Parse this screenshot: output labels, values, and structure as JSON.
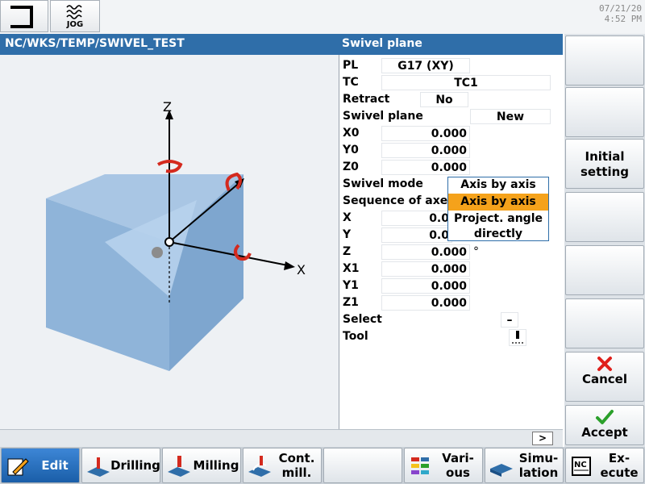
{
  "top": {
    "mode_label": "JOG",
    "date": "07/21/20",
    "time": "4:52 PM"
  },
  "titlebar": {
    "path": "NC/WKS/TEMP/SWIVEL_TEST",
    "panel_title": "Swivel plane"
  },
  "graphic": {
    "axis_x": "X",
    "axis_z": "Z"
  },
  "form": {
    "pl": {
      "label": "PL",
      "value": "G17 (XY)"
    },
    "tc": {
      "label": "TC",
      "value": "TC1"
    },
    "retract": {
      "label": "Retract",
      "value": "No"
    },
    "swivel_plane": {
      "label": "Swivel plane",
      "value": "New"
    },
    "x0": {
      "label": "X0",
      "value": "0.000"
    },
    "y0": {
      "label": "Y0",
      "value": "0.000"
    },
    "z0": {
      "label": "Z0",
      "value": "0.000"
    },
    "swivel_mode": {
      "label": "Swivel mode",
      "value": "Axis by axis",
      "options": [
        "Axis by axis",
        "Project. angle directly"
      ]
    },
    "sequence": {
      "label": "Sequence of axes"
    },
    "x": {
      "label": "X",
      "value": "0.0"
    },
    "y": {
      "label": "Y",
      "value": "0.0"
    },
    "z": {
      "label": "Z",
      "value": "0.000",
      "unit": "°"
    },
    "x1": {
      "label": "X1",
      "value": "0.000"
    },
    "y1": {
      "label": "Y1",
      "value": "0.000"
    },
    "z1": {
      "label": "Z1",
      "value": "0.000"
    },
    "select": {
      "label": "Select",
      "value": "–"
    },
    "tool": {
      "label": "Tool"
    }
  },
  "status": {
    "more_label": ">"
  },
  "vertical_softkeys": {
    "initial_setting": [
      "Initial",
      "setting"
    ],
    "cancel": "Cancel",
    "accept": "Accept"
  },
  "horizontal_softkeys": {
    "edit": "Edit",
    "drilling": "Drilling",
    "milling": "Milling",
    "cont_mill": [
      "Cont.",
      "mill."
    ],
    "various": [
      "Vari-",
      "ous"
    ],
    "simulation": [
      "Simu-",
      "lation"
    ],
    "execute": [
      "Ex-",
      "ecute"
    ]
  },
  "colors": {
    "title_bar": "#2f6ea9",
    "dropdown_highlight": "#f5a21b",
    "active_softkey": "#1a5ea8",
    "cancel_icon": "#e0201b",
    "accept_icon": "#2ba02b",
    "swivel_arrow": "#d42a1e",
    "cube_face": "#8fb4d9"
  }
}
